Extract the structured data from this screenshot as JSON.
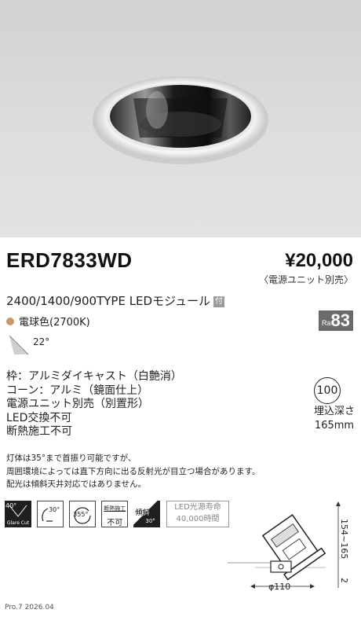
{
  "product": {
    "model": "ERD7833WD",
    "price": "¥20,000",
    "price_note": "〈電源ユニット別売〉",
    "type_line": "2400/1400/900TYPE LEDモジュール",
    "type_badge": "付",
    "color_temp": "電球色(2700K)",
    "ra_label": "Ra",
    "ra_value": "83",
    "beam_angle": "22°"
  },
  "specs": [
    "枠：アルミダイキャスト（白艶消）",
    "コーン：アルミ（鏡面仕上）",
    "電源ユニット別売（別置形）",
    "LED交換不可",
    "断熱施工不可"
  ],
  "embed": {
    "circle": "100",
    "label": "埋込深さ",
    "value": "165mm"
  },
  "notes": [
    "灯体は35°まで首振り可能ですが、",
    "周囲環境によっては直下方向に出る反射光が目立つ場合があります。",
    "配光は傾斜天井対応ではありません。"
  ],
  "icons": [
    {
      "name": "glare-cut-icon",
      "top": "40°",
      "bottom": "Glare Cut"
    },
    {
      "name": "tilt-30-icon",
      "top": "30°",
      "bottom": ""
    },
    {
      "name": "rotate-355-icon",
      "top": "355°",
      "bottom": ""
    },
    {
      "name": "insulation-icon",
      "top": "断熱施工",
      "bottom": "不可"
    },
    {
      "name": "slope-ceiling-icon",
      "top": "傾斜",
      "bottom": "30°"
    }
  ],
  "life": {
    "line1": "LED光源寿命",
    "line2": "40,000時間"
  },
  "dims": {
    "height": "154~165",
    "depth_mark": "2",
    "hole": "φ110"
  },
  "footer": "Pro.7 2026.04",
  "colors": {
    "warm_dot": "#c99a67",
    "ra_badge": "#6b6b6b"
  }
}
